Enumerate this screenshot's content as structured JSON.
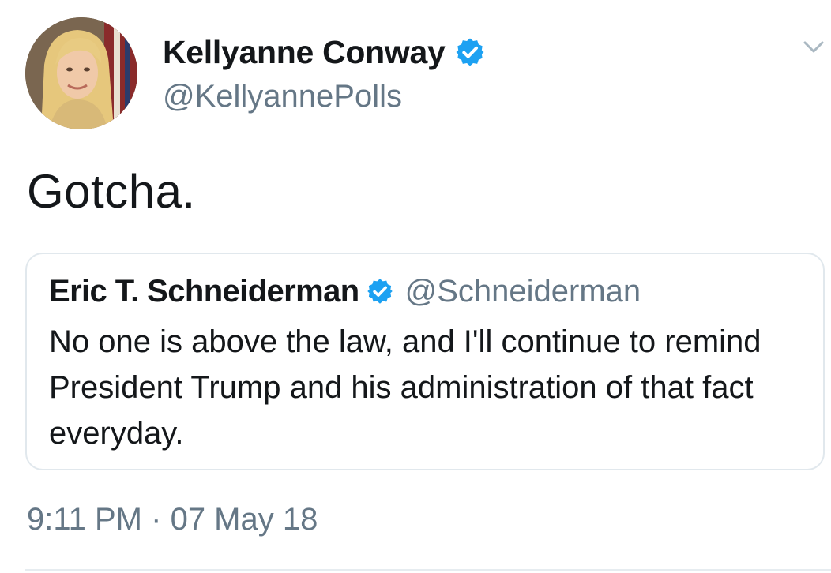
{
  "tweet": {
    "author": {
      "display_name": "Kellyanne Conway",
      "handle": "@KellyannePolls",
      "verified": true,
      "avatar": "profile-photo"
    },
    "text": "Gotcha.",
    "quoted_tweet": {
      "display_name": "Eric T. Schneiderman",
      "handle": "@Schneiderman",
      "verified": true,
      "text": "No one is above the law, and I'll continue to remind President Trump and his administration of that fact everyday."
    },
    "time": "9:11 PM",
    "separator": "·",
    "date": "07 May 18"
  },
  "icons": {
    "verified": "verified-badge-icon",
    "menu": "chevron-down-icon"
  },
  "colors": {
    "primary_text": "#14171a",
    "secondary_text": "#657786",
    "verified_blue": "#1da1f2",
    "border": "#e1e8ed"
  }
}
